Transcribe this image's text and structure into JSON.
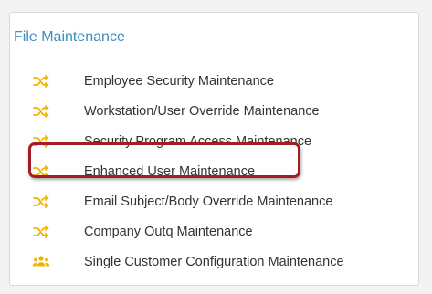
{
  "panel": {
    "title": "File Maintenance",
    "title_color": "#3c8dbc",
    "highlight_color": "#a51d24"
  },
  "menu": {
    "items": [
      {
        "label": "Employee Security Maintenance",
        "icon": "shuffle-icon",
        "icon_color": "#f0b400"
      },
      {
        "label": "Workstation/User Override Maintenance",
        "icon": "shuffle-icon",
        "icon_color": "#f0b400"
      },
      {
        "label": "Security Program Access Maintenance",
        "icon": "shuffle-icon",
        "icon_color": "#f0b400"
      },
      {
        "label": "Enhanced User Maintenance",
        "icon": "shuffle-icon",
        "icon_color": "#f0b400",
        "highlighted": true
      },
      {
        "label": "Email Subject/Body Override Maintenance",
        "icon": "shuffle-icon",
        "icon_color": "#f0b400"
      },
      {
        "label": "Company Outq Maintenance",
        "icon": "shuffle-icon",
        "icon_color": "#f0b400"
      },
      {
        "label": "Single Customer Configuration Maintenance",
        "icon": "users-icon",
        "icon_color": "#f0b400"
      }
    ]
  }
}
